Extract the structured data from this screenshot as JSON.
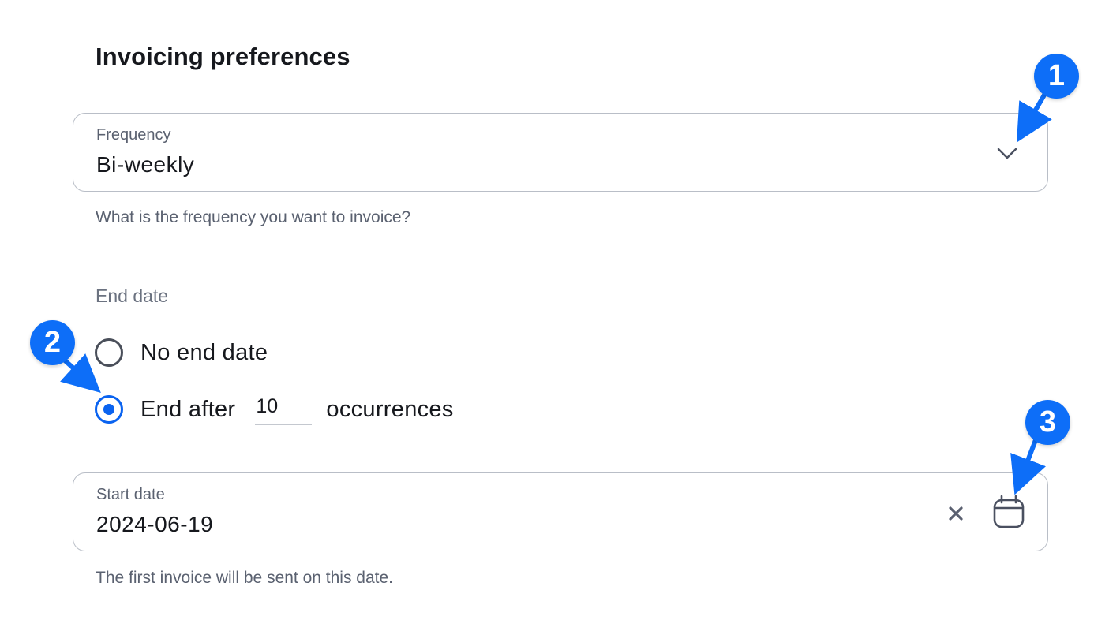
{
  "page": {
    "title": "Invoicing preferences"
  },
  "frequency": {
    "label": "Frequency",
    "value": "Bi-weekly",
    "helper": "What is the frequency you want to invoice?",
    "icon": "chevron-down-icon"
  },
  "end_date": {
    "label": "End date",
    "options": [
      {
        "label": "No end date",
        "selected": false
      },
      {
        "label_before": "End after",
        "occurrences": "10",
        "label_after": "occurrences",
        "selected": true
      }
    ]
  },
  "start_date": {
    "label": "Start date",
    "value": "2024-06-19",
    "helper": "The first invoice will be sent on this date.",
    "clear_icon": "close-icon",
    "calendar_icon": "calendar-icon"
  },
  "annotations": [
    "1",
    "2",
    "3"
  ],
  "colors": {
    "accent": "#0a63f0",
    "marker": "#0d6ef8",
    "border": "#b9bec7",
    "muted_text": "#5a6170"
  }
}
